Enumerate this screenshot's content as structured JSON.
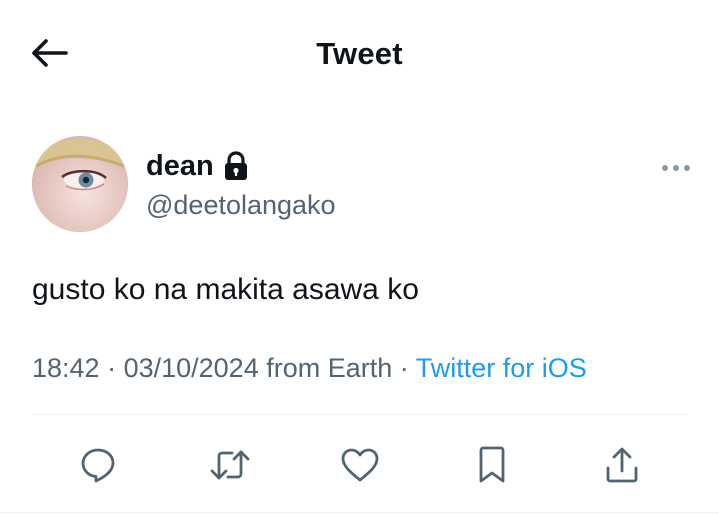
{
  "header": {
    "title": "Tweet",
    "back_icon": "arrow-left-icon"
  },
  "tweet": {
    "author": {
      "display_name": "dean",
      "handle": "@deetolangako",
      "protected": true,
      "lock_icon": "lock-icon",
      "avatar": "avatar-image"
    },
    "more_icon": "more-horizontal-icon",
    "text": "gusto ko na makita asawa ko",
    "meta": {
      "time": "18:42",
      "separator": " · ",
      "date": "03/10/2024",
      "location": " from Earth",
      "separator2": " · ",
      "source": "Twitter for iOS"
    },
    "actions": [
      {
        "name": "reply",
        "icon": "reply-icon"
      },
      {
        "name": "retweet",
        "icon": "retweet-icon"
      },
      {
        "name": "like",
        "icon": "heart-icon"
      },
      {
        "name": "bookmark",
        "icon": "bookmark-icon"
      },
      {
        "name": "share",
        "icon": "share-icon"
      }
    ]
  },
  "colors": {
    "text_primary": "#0f1419",
    "text_secondary": "#536471",
    "link": "#1d9bf0",
    "divider": "#eff3f4"
  }
}
